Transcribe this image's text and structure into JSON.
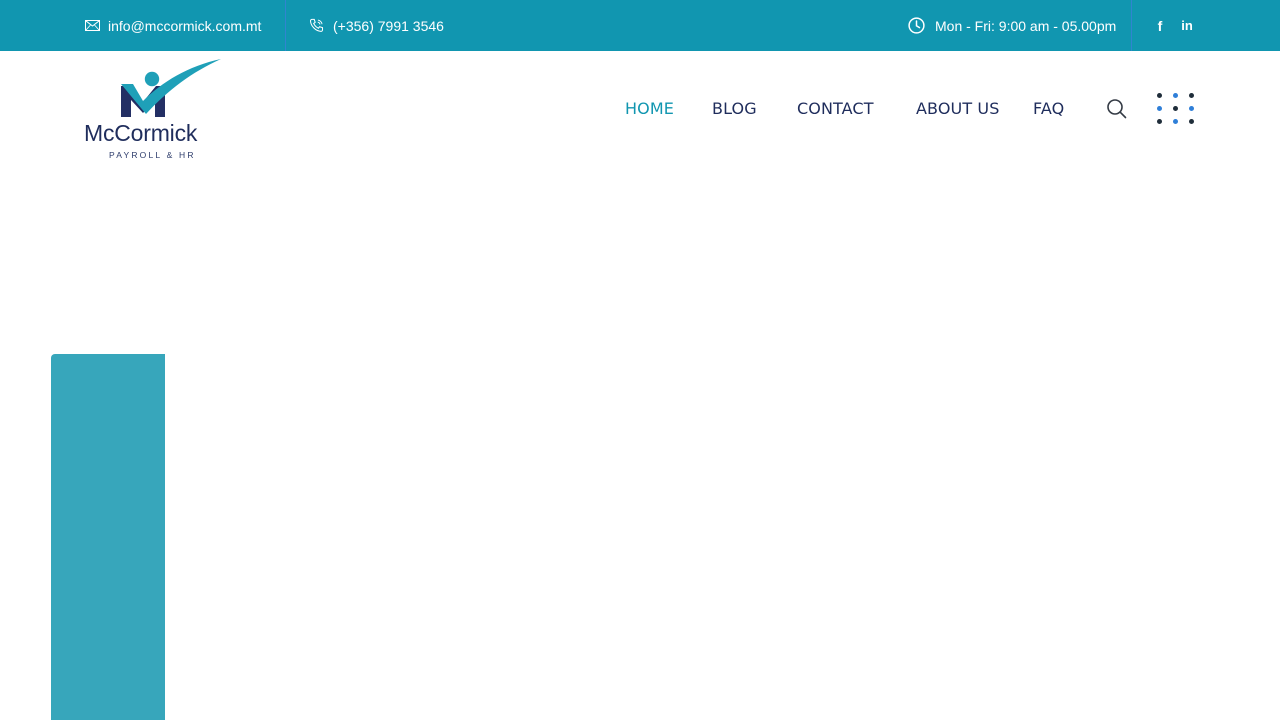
{
  "topbar": {
    "email": "info@mccormick.com.mt",
    "phone": "(+356) 7991 3546",
    "hours": "Mon - Fri: 9:00 am - 05.00pm",
    "social": [
      {
        "icon": "facebook-icon",
        "label": "f"
      },
      {
        "icon": "linkedin-icon",
        "label": "in"
      }
    ]
  },
  "logo": {
    "name": "McCormick",
    "tagline": "PAYROLL & HR"
  },
  "nav": {
    "items": [
      {
        "label": "HOME",
        "active": true
      },
      {
        "label": "BLOG",
        "active": false
      },
      {
        "label": "CONTACT",
        "active": false
      },
      {
        "label": "ABOUT US",
        "active": false
      },
      {
        "label": "FAQ",
        "active": false
      }
    ]
  },
  "colors": {
    "topbar": "#1196b0",
    "nav_text": "#1f2d5c",
    "nav_active": "#1196b0",
    "accent_panel": "#37a6bb",
    "dot_blue": "#2f7fd8",
    "dot_dark": "#1f2d3a"
  },
  "icons": {
    "email": "envelope-icon",
    "phone": "phone-icon",
    "hours": "clock-icon",
    "search": "search-icon",
    "menu": "dots-grid-icon"
  }
}
